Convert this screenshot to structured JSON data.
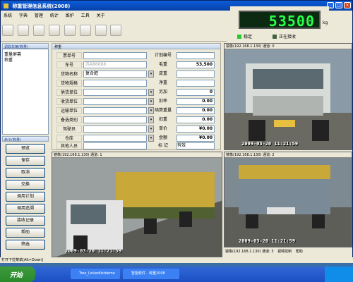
{
  "window": {
    "title": "称重管理信息系统(2008)"
  },
  "menu": [
    "系统",
    "字典",
    "管理",
    "统计",
    "维护",
    "工具",
    "关于"
  ],
  "scale": {
    "weight": "53500",
    "unit": "kg",
    "stable": "稳定",
    "receiving": "正在接收"
  },
  "left": {
    "header": "调取车辆(数量)",
    "files": [
      "重量屏幕",
      "称重"
    ],
    "cmd_header": "命令(数量)",
    "buttons": [
      "预览",
      "保存",
      "取消",
      "交换",
      "调用计划",
      "调用追溯",
      "接收记录",
      "帮助",
      "筛选"
    ]
  },
  "form": {
    "header": "称重",
    "fields": [
      {
        "label": "票单号",
        "value": "",
        "right_label": "计划编号",
        "right_value": ""
      },
      {
        "label": "车号",
        "value": "苏A88888",
        "right_label": "毛重",
        "right_value": "53,500"
      },
      {
        "label": "货物名称",
        "value": "复合肥",
        "right_label": "皮重",
        "right_value": ""
      },
      {
        "label": "货物规格",
        "value": "",
        "right_label": "净重",
        "right_value": ""
      },
      {
        "label": "供货单位",
        "value": "",
        "right_label": "另加",
        "right_value": "0"
      },
      {
        "label": "收货单位",
        "value": "",
        "right_label": "扣率",
        "right_value": "0.00"
      },
      {
        "label": "运输单位",
        "value": "",
        "right_label": "结算重量",
        "right_value": "0.00"
      },
      {
        "label": "备选类别",
        "value": "",
        "right_label": "扣重",
        "right_value": "0.00"
      },
      {
        "label": "驾驶员",
        "value": "",
        "right_label": "单价",
        "right_value": "¥0.00"
      },
      {
        "label": "仓库",
        "value": "",
        "right_label": "金额",
        "right_value": "¥0.00"
      },
      {
        "label": "其他人员",
        "value": "",
        "right_label": "标 记",
        "right_value": "有效"
      }
    ]
  },
  "cameras": [
    {
      "header": "镜像(192.168.1.130) 通道: 0",
      "timestamp": "2009-03-20 11:21:59"
    },
    {
      "header": "镜像(192.168.1.130) 通道: 1",
      "timestamp": "2009-03-20 11:21:59"
    },
    {
      "header": "镜像(192.168.1.130) 通道: 2",
      "timestamp": "2009-03-20 11:21:59"
    },
    {
      "header": "镜像(192.168.1.130) 通道: 3",
      "timestamp": ""
    }
  ],
  "camera_bar": [
    "视频控制",
    "帮助"
  ],
  "status": "打开下拉菜单[Alt+Down]",
  "taskbar": {
    "start": "开始",
    "tasks": [
      "Tree_Linkedlistdemo",
      "智能软件 - 称重2008"
    ]
  },
  "colors": {
    "display_bg": "#0c2a12",
    "display_text": "#28ff48",
    "title_bar": "#0a5cd8"
  }
}
